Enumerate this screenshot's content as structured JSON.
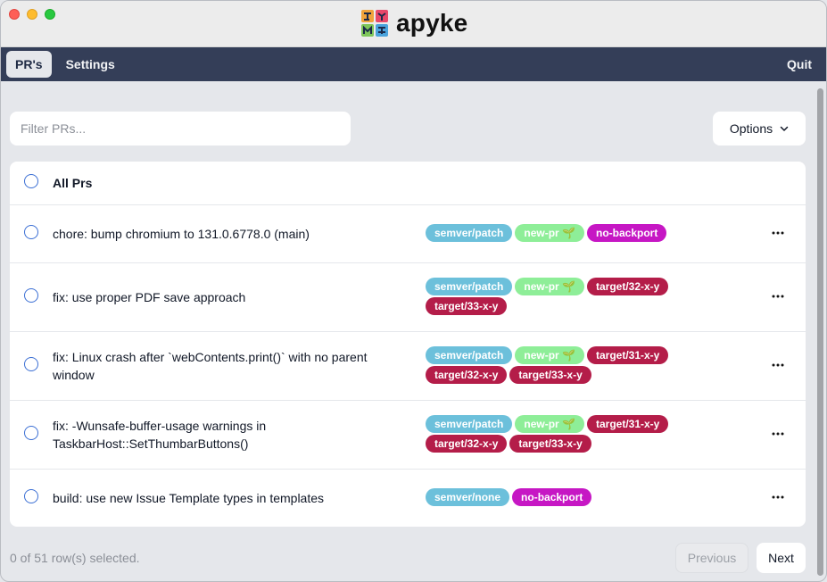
{
  "window": {
    "title": "apyke",
    "logo_icon": "puzzle-logo-icon"
  },
  "nav": {
    "tabs": [
      {
        "label": "PR's",
        "active": true
      },
      {
        "label": "Settings",
        "active": false
      }
    ],
    "quit_label": "Quit"
  },
  "filter": {
    "placeholder": "Filter PRs...",
    "value": ""
  },
  "options": {
    "label": "Options",
    "icon": "chevron-down-icon"
  },
  "table": {
    "header_label": "All Prs",
    "rows": [
      {
        "title": "chore: bump chromium to 131.0.6778.0 (main)",
        "labels": [
          {
            "text": "semver/patch",
            "color": "#6cc0db"
          },
          {
            "text": "new-pr 🌱",
            "color": "#8eee98"
          },
          {
            "text": "no-backport",
            "color": "#c617c4"
          }
        ]
      },
      {
        "title": "fix: use proper PDF save approach",
        "labels": [
          {
            "text": "semver/patch",
            "color": "#6cc0db"
          },
          {
            "text": "new-pr 🌱",
            "color": "#8eee98"
          },
          {
            "text": "target/32-x-y",
            "color": "#b41d49"
          },
          {
            "text": "target/33-x-y",
            "color": "#b41d49"
          }
        ]
      },
      {
        "title": "fix: Linux crash after `webContents.print()` with no parent window",
        "labels": [
          {
            "text": "semver/patch",
            "color": "#6cc0db"
          },
          {
            "text": "new-pr 🌱",
            "color": "#8eee98"
          },
          {
            "text": "target/31-x-y",
            "color": "#b41d49"
          },
          {
            "text": "target/32-x-y",
            "color": "#b41d49"
          },
          {
            "text": "target/33-x-y",
            "color": "#b41d49"
          }
        ]
      },
      {
        "title": "fix: -Wunsafe-buffer-usage warnings in TaskbarHost::SetThumbarButtons()",
        "labels": [
          {
            "text": "semver/patch",
            "color": "#6cc0db"
          },
          {
            "text": "new-pr 🌱",
            "color": "#8eee98"
          },
          {
            "text": "target/31-x-y",
            "color": "#b41d49"
          },
          {
            "text": "target/32-x-y",
            "color": "#b41d49"
          },
          {
            "text": "target/33-x-y",
            "color": "#b41d49"
          }
        ]
      },
      {
        "title": "build: use new Issue Template types in templates",
        "labels": [
          {
            "text": "semver/none",
            "color": "#6cc0db"
          },
          {
            "text": "no-backport",
            "color": "#c617c4"
          }
        ]
      }
    ],
    "row_action_icon": "more-horizontal-icon"
  },
  "footer": {
    "status": "0 of 51 row(s) selected.",
    "previous_label": "Previous",
    "next_label": "Next"
  }
}
